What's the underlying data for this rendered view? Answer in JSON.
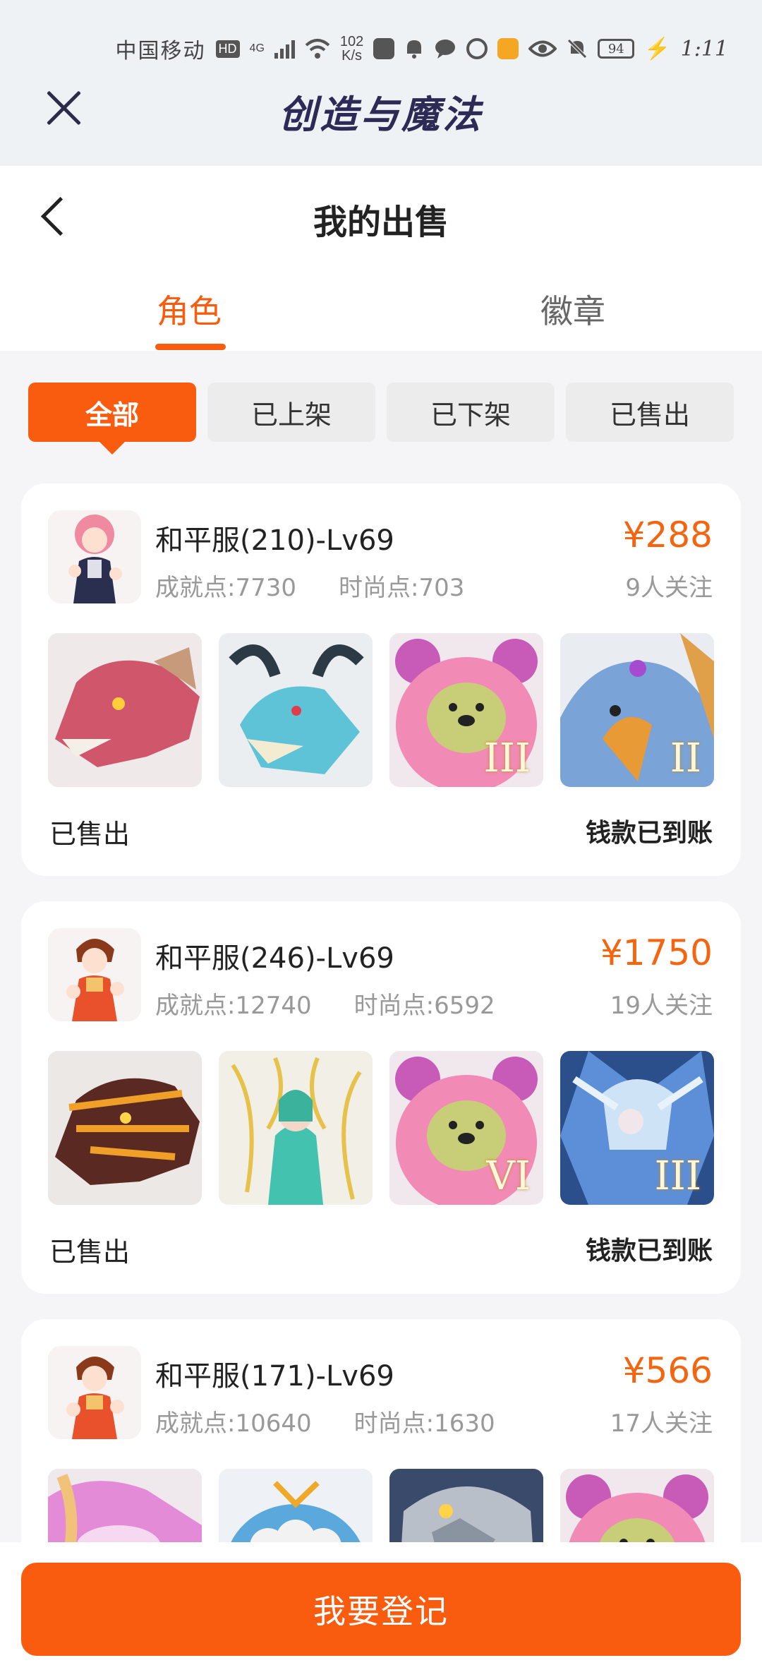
{
  "status_bar": {
    "carrier": "中国移动",
    "hd": "HD",
    "net_type": "4G",
    "speed_value": "102",
    "speed_unit": "K/s",
    "battery": "94",
    "time": "1:11"
  },
  "app_bar": {
    "title": "创造与魔法",
    "close_icon": "close-icon"
  },
  "page": {
    "title": "我的出售",
    "back_icon": "chevron-left-icon"
  },
  "tabs": [
    {
      "label": "角色",
      "active": true
    },
    {
      "label": "徽章",
      "active": false
    }
  ],
  "filters": [
    {
      "label": "全部",
      "active": true
    },
    {
      "label": "已上架",
      "active": false
    },
    {
      "label": "已下架",
      "active": false
    },
    {
      "label": "已售出",
      "active": false
    }
  ],
  "listings": [
    {
      "server": "和平服(210)-Lv69",
      "achievement": "成就点:7730",
      "fashion": "时尚点:703",
      "price": "¥288",
      "followers": "9人关注",
      "status": "已售出",
      "payment": "钱款已到账",
      "thumbs": [
        {
          "name": "red-dragon-mount",
          "level": ""
        },
        {
          "name": "ice-dragon-mount",
          "level": ""
        },
        {
          "name": "pink-bear-pet",
          "level": "III"
        },
        {
          "name": "blue-eagle-pet",
          "level": "II"
        }
      ]
    },
    {
      "server": "和平服(246)-Lv69",
      "achievement": "成就点:12740",
      "fashion": "时尚点:6592",
      "price": "¥1750",
      "followers": "19人关注",
      "status": "已售出",
      "payment": "钱款已到账",
      "thumbs": [
        {
          "name": "fire-dragon-mount",
          "level": ""
        },
        {
          "name": "golden-goddess-pet",
          "level": ""
        },
        {
          "name": "pink-bear-pet",
          "level": "VI"
        },
        {
          "name": "frost-warrior-pet",
          "level": "III"
        }
      ]
    },
    {
      "server": "和平服(171)-Lv69",
      "achievement": "成就点:10640",
      "fashion": "时尚点:1630",
      "price": "¥566",
      "followers": "17人关注",
      "thumbs": [
        {
          "name": "pink-dragon-mount",
          "level": ""
        },
        {
          "name": "blue-sheep-pet",
          "level": ""
        },
        {
          "name": "stone-golem-pet",
          "level": ""
        },
        {
          "name": "pink-bear-pet",
          "level": ""
        }
      ]
    }
  ],
  "bottom": {
    "register_label": "我要登记"
  },
  "colors": {
    "accent": "#f95c0e",
    "price": "#f5640f",
    "title_navy": "#2d2a55"
  }
}
